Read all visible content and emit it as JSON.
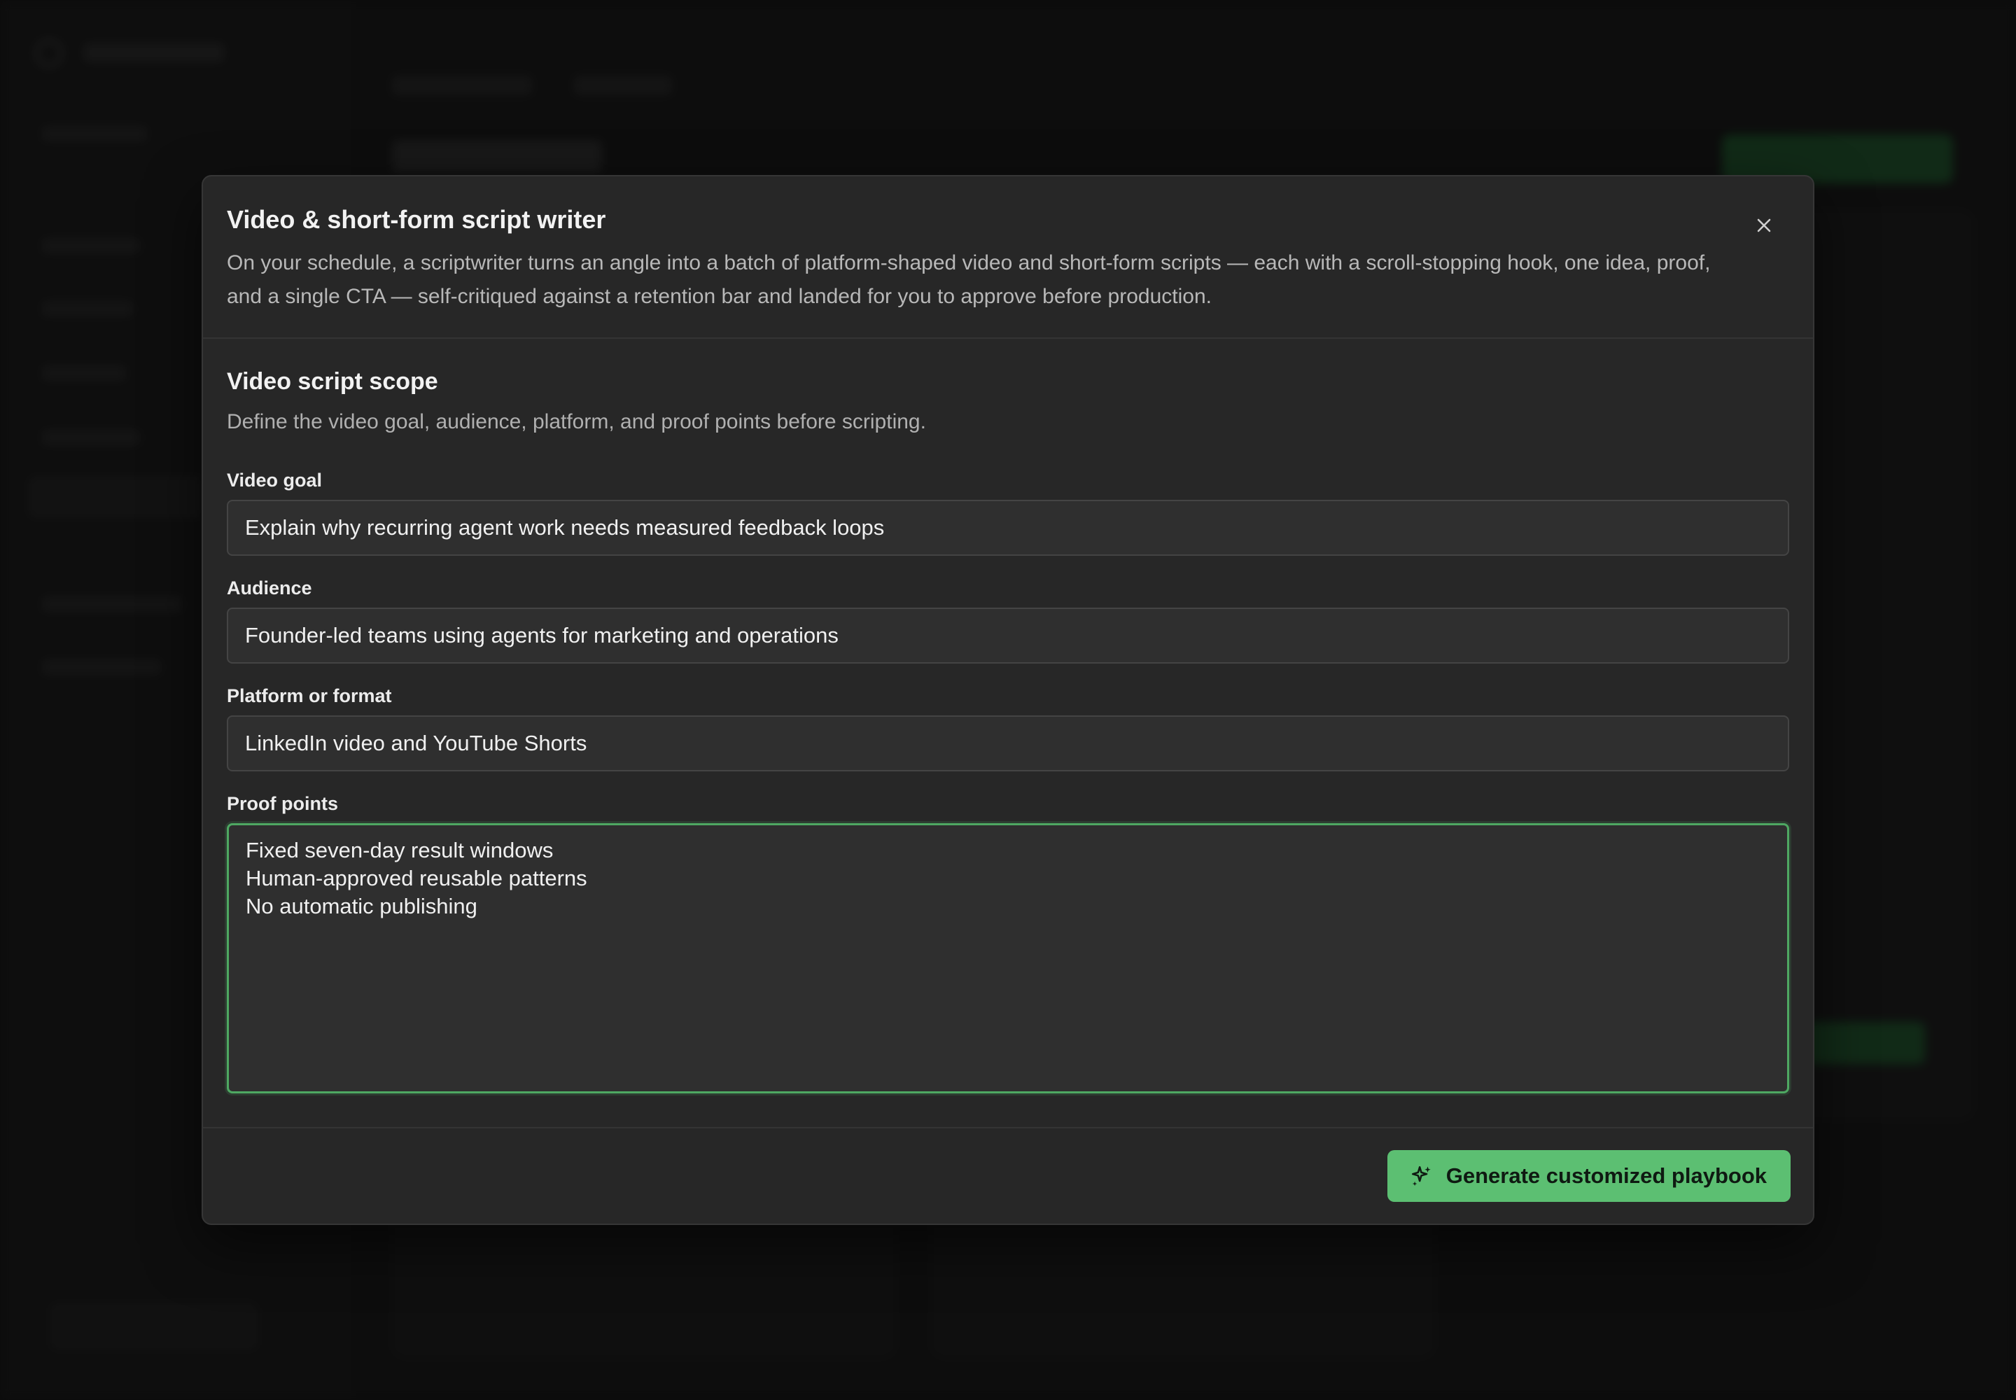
{
  "modal": {
    "title": "Video & short-form script writer",
    "description": "On your schedule, a scriptwriter turns an angle into a batch of platform-shaped video and short-form scripts — each with a scroll-stopping hook, one idea, proof, and a single CTA — self-critiqued against a retention bar and landed for you to approve before production.",
    "close_icon": "close-icon"
  },
  "section": {
    "title": "Video script scope",
    "description": "Define the video goal, audience, platform, and proof points before scripting."
  },
  "fields": {
    "video_goal": {
      "label": "Video goal",
      "value": "Explain why recurring agent work needs measured feedback loops"
    },
    "audience": {
      "label": "Audience",
      "value": "Founder-led teams using agents for marketing and operations"
    },
    "platform": {
      "label": "Platform or format",
      "value": "LinkedIn video and YouTube Shorts"
    },
    "proof_points": {
      "label": "Proof points",
      "value": "Fixed seven-day result windows\nHuman-approved reusable patterns\nNo automatic publishing"
    }
  },
  "footer": {
    "generate_label": "Generate customized playbook",
    "generate_icon": "sparkles-icon"
  },
  "colors": {
    "accent": "#5cbf72",
    "focus_border": "#4ea862",
    "modal_bg": "#272727",
    "page_bg": "#161616"
  }
}
